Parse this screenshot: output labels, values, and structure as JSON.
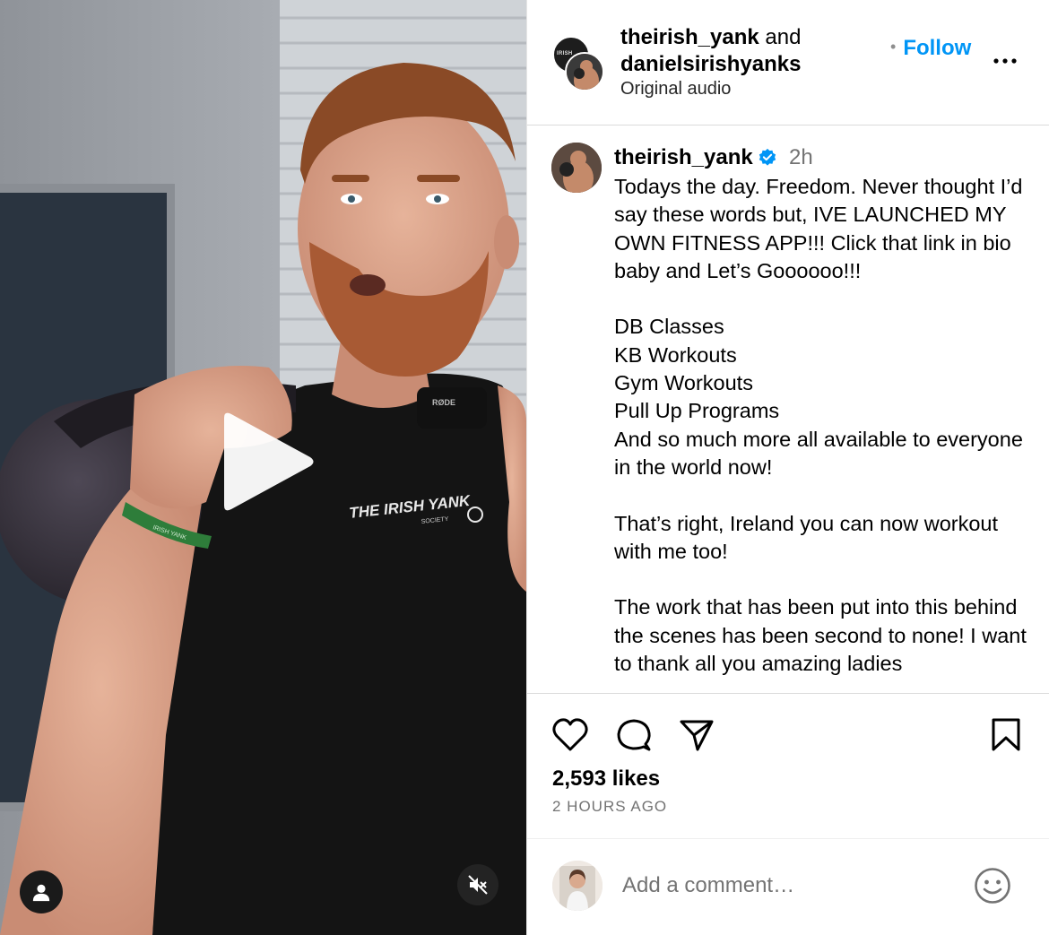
{
  "video": {
    "shirt_text": "THE IRISH YANK",
    "shirt_subtext": "SOCIETY",
    "mic_text": "RØDE",
    "wristband_text": "IRISH YANK",
    "controls": {
      "play_icon": "play-icon",
      "user_icon": "user-icon",
      "mute_icon": "speaker-muted-icon"
    }
  },
  "header": {
    "avatar_back_text": "IRISH",
    "user1": "theirish_yank",
    "conjunction": " and",
    "user2": "danielsirishyanks",
    "audio": "Original audio",
    "separator": "•",
    "follow": "Follow",
    "more_icon": "more-icon"
  },
  "caption": {
    "username": "theirish_yank",
    "verified_icon": "verified-badge-icon",
    "time": "2h",
    "text": "Todays the day. Freedom. Never thought I’d say these words but, IVE LAUNCHED MY OWN FITNESS APP!!! Click that link in bio baby and Let’s Goooooo!!!\n\nDB Classes\nKB Workouts\nGym Workouts\nPull Up Programs\nAnd so much more all available to everyone in the world now!\n\nThat’s right, Ireland you can now workout with me too!\n\nThe work that has been put into this behind the scenes has been second to none! I want to thank all you amazing ladies"
  },
  "actions": {
    "like_icon": "heart-icon",
    "comment_icon": "comment-icon",
    "share_icon": "share-icon",
    "save_icon": "bookmark-icon",
    "likes": "2,593 likes",
    "time_ago": "2 HOURS AGO"
  },
  "comment": {
    "placeholder": "Add a comment…",
    "emoji_icon": "emoji-icon"
  },
  "colors": {
    "follow_blue": "#0095f6",
    "verified_blue": "#0095f6",
    "muted_text": "#737373"
  }
}
